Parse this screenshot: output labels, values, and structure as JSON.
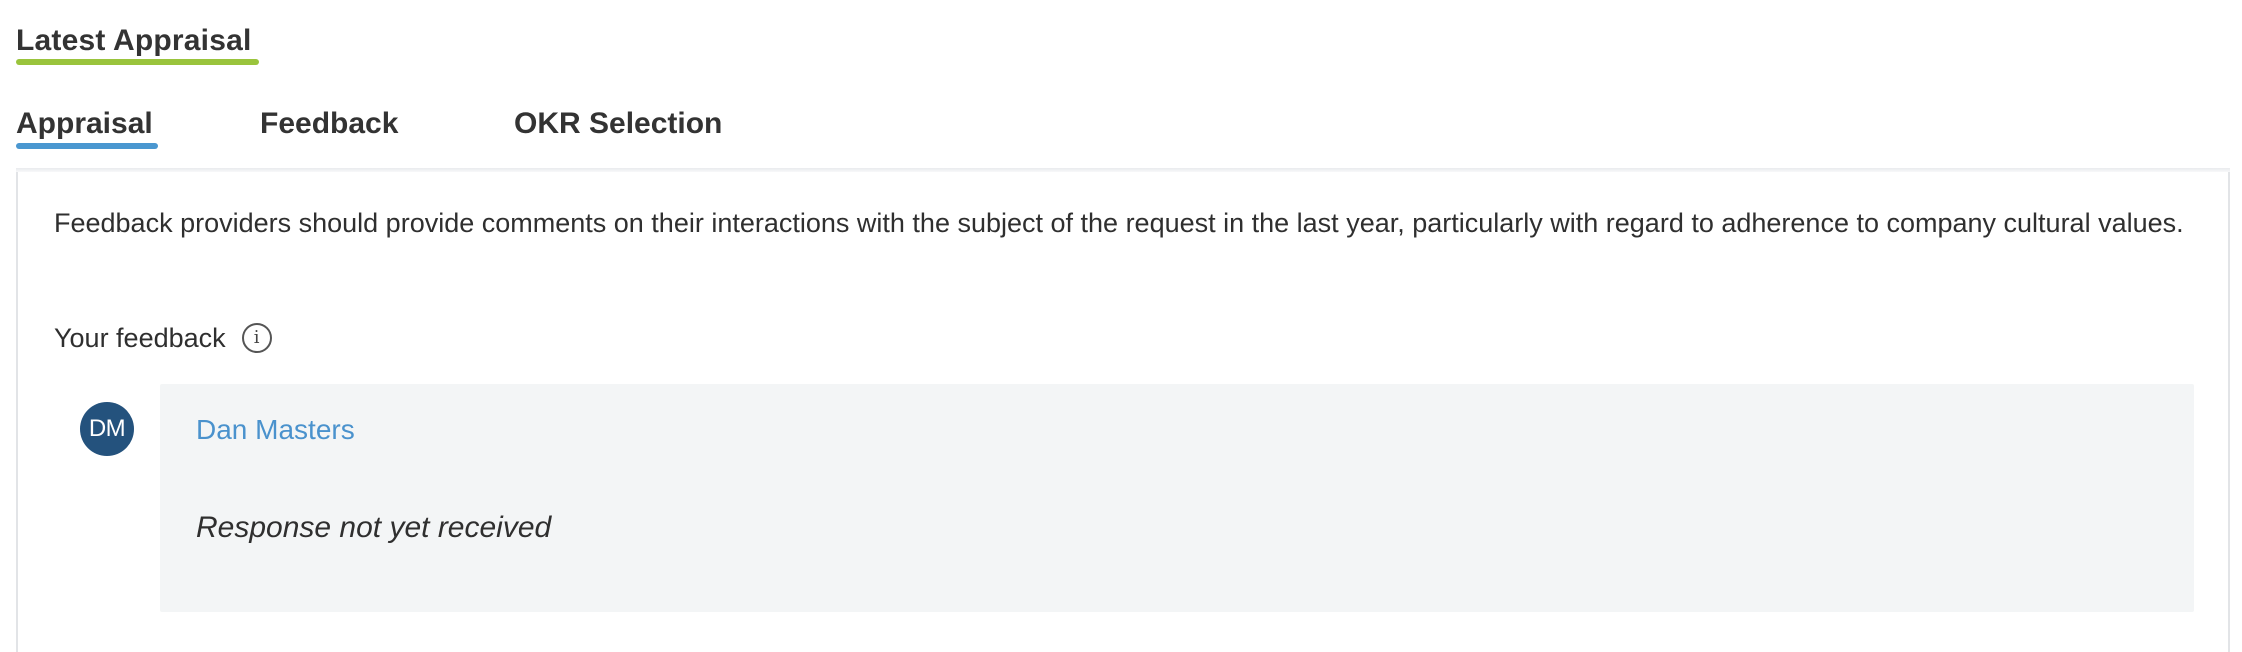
{
  "section": {
    "title": "Latest Appraisal",
    "accent_color": "#9ac43c"
  },
  "tabs": [
    {
      "label": "Appraisal",
      "active": true
    },
    {
      "label": "Feedback",
      "active": false
    },
    {
      "label": "OKR Selection",
      "active": false
    }
  ],
  "active_tab_color": "#4a97d0",
  "panel": {
    "description": "Feedback providers should provide comments on their interactions with the subject of the request in the last year, particularly with regard to adherence to company cultural values.",
    "your_feedback_label": "Your feedback",
    "info_icon_glyph": "i"
  },
  "feedback_entries": [
    {
      "avatar_initials": "DM",
      "avatar_color": "#24527d",
      "name": "Dan Masters",
      "name_color": "#4a92cd",
      "status": "Response not yet received"
    }
  ]
}
